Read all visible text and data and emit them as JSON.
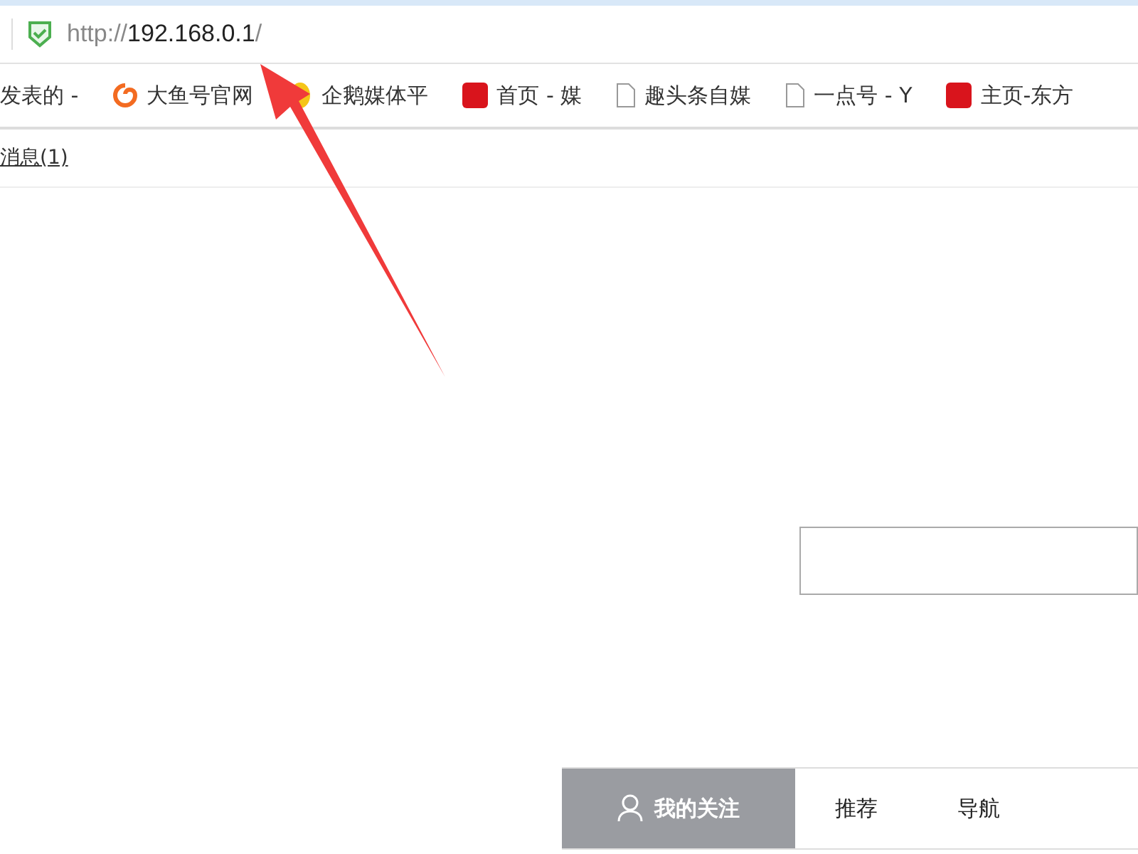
{
  "address_bar": {
    "scheme": "http://",
    "host": "192.168.0.1",
    "path": "/"
  },
  "bookmarks": [
    {
      "label": "发表的 -"
    },
    {
      "label": "大鱼号官网"
    },
    {
      "label": "企鹅媒体平"
    },
    {
      "label": "首页 - 媒"
    },
    {
      "label": "趣头条自媒"
    },
    {
      "label": "一点号 - Y"
    },
    {
      "label": "主页-东方"
    }
  ],
  "messages_link": "消息(1)",
  "tabs": [
    {
      "label": "我的关注",
      "selected": true
    },
    {
      "label": "推荐",
      "selected": false
    },
    {
      "label": "导航",
      "selected": false
    }
  ]
}
